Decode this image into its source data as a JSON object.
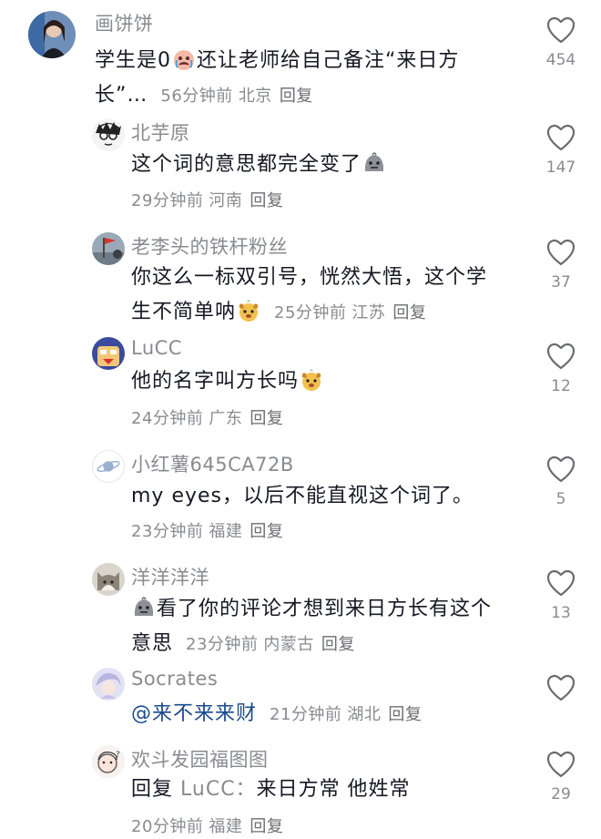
{
  "comments": [
    {
      "username": "画饼饼",
      "text_parts": [
        "学生是0",
        "还让老师给自己备注“来日方长”…"
      ],
      "time": "56分钟前",
      "location": "北京",
      "reply_label": "回复",
      "likes": "454"
    },
    {
      "username": "北芋原",
      "text": "这个词的意思都完全变了",
      "time": "29分钟前",
      "location": "河南",
      "reply_label": "回复",
      "likes": "147"
    },
    {
      "username": "老李头的铁杆粉丝",
      "text_line1": "你这么一标双引号，恍然大悟，这个学",
      "text_line2": "生不简单呐",
      "time": "25分钟前",
      "location": "江苏",
      "reply_label": "回复",
      "likes": "37"
    },
    {
      "username": "LuCC",
      "text": "他的名字叫方长吗",
      "time": "24分钟前",
      "location": "广东",
      "reply_label": "回复",
      "likes": "12"
    },
    {
      "username": "小红薯645CA72B",
      "text": "my eyes，以后不能直视这个词了。",
      "time": "23分钟前",
      "location": "福建",
      "reply_label": "回复",
      "likes": "5"
    },
    {
      "username": "洋洋洋洋",
      "text_line1": "看了你的评论才想到来日方长有这个",
      "text_line2": "意思",
      "time": "23分钟前",
      "location": "内蒙古",
      "reply_label": "回复",
      "likes": "13"
    },
    {
      "username": "Socrates",
      "mention": "@来不来来财",
      "time": "21分钟前",
      "location": "湖北",
      "reply_label": "回复",
      "likes": ""
    },
    {
      "username": "欢斗发园福图图",
      "reply_prefix": "回复",
      "reply_target": "LuCC：",
      "text": "来日方常 他姓常",
      "time": "20分钟前",
      "location": "福建",
      "reply_label": "回复",
      "likes": "29"
    }
  ],
  "icons": {
    "like": "heart-outline-icon",
    "emoji_cry": "crying-face-emoji",
    "emoji_ghost": "grey-blob-emoji",
    "emoji_dog": "yellow-puppy-emoji"
  },
  "colors": {
    "text": "#161823",
    "secondary": "#8a8b91",
    "mention": "#1a4a8c"
  }
}
